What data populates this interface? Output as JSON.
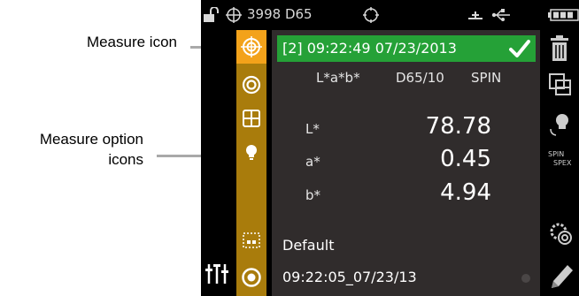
{
  "callouts": {
    "measure_icon": "Measure icon",
    "measure_option_line1": "Measure option",
    "measure_option_line2": "icons"
  },
  "statusbar": {
    "instrument_text": "3998 D65",
    "icons": [
      "unlock-icon",
      "target-crosshair-icon",
      "crosshair-circle-icon",
      "network-icon",
      "usb-icon",
      "battery-icon"
    ]
  },
  "sidebar": {
    "options": [
      "measure-icon",
      "concentric-rings-icon",
      "grid-icon",
      "lightbulb-icon",
      "aperture-frame-icon",
      "settings-sliders-icon",
      "measure-ring-icon"
    ]
  },
  "measurement": {
    "header": "[2] 09:22:49 07/23/2013",
    "color_space": "L*a*b*",
    "illuminant": "D65/10",
    "mode": "SPIN",
    "rows": [
      {
        "label": "L*",
        "value": "78.78"
      },
      {
        "label": "a*",
        "value": "0.45"
      },
      {
        "label": "b*",
        "value": "4.94"
      }
    ],
    "standard_name": "Default",
    "standard_time": "09:22:05_07/23/13"
  },
  "right_toolbar": {
    "spin_label": "SPIN",
    "spex_label": "SPEX",
    "icons": [
      "trash-icon",
      "compare-icon",
      "lightbulb-query-icon",
      "spin-spex-toggle-icon",
      "gear-target-icon",
      "pencil-icon"
    ]
  },
  "colors": {
    "header_green": "#25a137",
    "option_bar": "#a97c0c",
    "option_selected": "#f3a21a",
    "screen_background": "#302c2c"
  }
}
